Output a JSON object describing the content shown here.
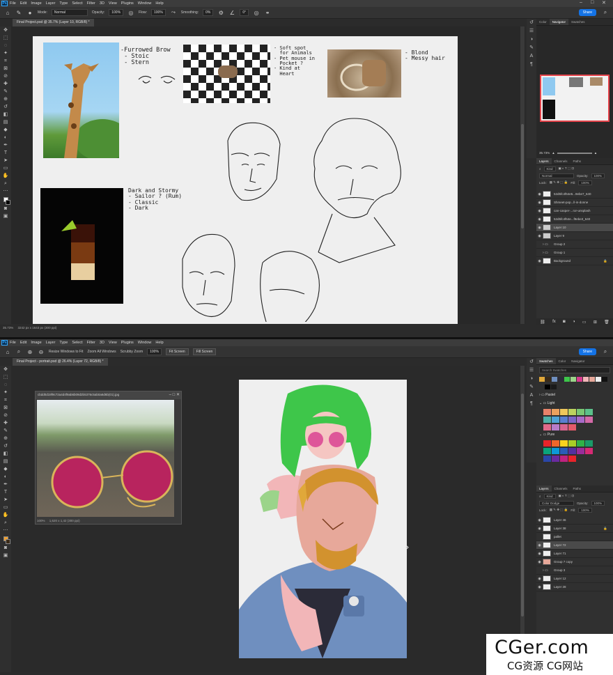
{
  "top": {
    "menu": [
      "File",
      "Edit",
      "Image",
      "Layer",
      "Type",
      "Select",
      "Filter",
      "3D",
      "View",
      "Plugins",
      "Window",
      "Help"
    ],
    "options": {
      "mode_label": "Mode:",
      "mode": "Normal",
      "opacity_label": "Opacity:",
      "opacity": "100%",
      "flow_label": "Flow:",
      "flow": "100%",
      "smoothing_label": "Smoothing:",
      "smoothing": "0%",
      "angle": "0°"
    },
    "share": "Share",
    "doc_tab": "Final Project.psd @ 35.7% (Layer 10, RGB/8) *",
    "status": "35.73%",
    "status_dims": "3242 px x 1643 px (300 ppi)",
    "notes": {
      "giraffe": "-Furrowed Brow\n - Stoic\n - Stern",
      "shirt": "- Soft spot\n  for Animals\n- Pet mouse in\n  Pocket ?\n- Kind at\n  Heart",
      "rope": "- Blond\n- Messy hair",
      "drink": "Dark and Stormy\n- Sailor ? (Rum)\n- Classic\n- Dark"
    },
    "panel_tabs": [
      "Color",
      "Navigator",
      "Swatches"
    ],
    "nav_zoom": "35.73%",
    "layers_tabs": [
      "Layers",
      "Channels",
      "Paths"
    ],
    "kind": "Kind",
    "blend": "Normal",
    "opacity_label": "Opacity:",
    "opacity": "100%",
    "lock_label": "Lock:",
    "fill_label": "Fill:",
    "fill": "100%",
    "layers": [
      "52d5fc4f64e5...9ebe7_640",
      "Shmeet-pop...ll-in-donne",
      "can-casper-...ror-unsplash",
      "52d5fc4f64e...f9ebe3_640",
      "Layer 10",
      "Layer 9",
      "Group 2",
      "Group 1",
      "Background"
    ]
  },
  "bottom": {
    "menu": [
      "File",
      "Edit",
      "Image",
      "Layer",
      "Type",
      "Select",
      "Filter",
      "3D",
      "View",
      "Plugins",
      "Window",
      "Help"
    ],
    "options": {
      "resize": "Resize Windows to Fit",
      "zoom_all": "Zoom All Windows",
      "scrubby": "Scrubby Zoom",
      "zoom": "100%",
      "fit": "Fit Screen",
      "fill": "Fill Screen"
    },
    "share": "Share",
    "doc_tab": "Final Project - portrait.psd @ 26.4% (Layer 72, RGB/8) *",
    "float_title": "cbdd0d19f9c72a4d4f9ab6b09d2b5376c5ab0a6d6b(01).jpg",
    "float_status": "100%",
    "float_dims": "1,620 x 1,42 (300 ppi)",
    "panel_tabs": [
      "Swatches",
      "Color",
      "Navigator"
    ],
    "search": "Search Swatches",
    "groups": [
      "Pastel",
      "Light",
      "Pure"
    ],
    "layers_tabs": [
      "Layers",
      "Channels",
      "Paths"
    ],
    "kind": "Kind",
    "blend": "Color Dodge",
    "opacity_label": "Opacity:",
    "opacity": "100%",
    "lock_label": "Lock:",
    "fill_label": "Fill:",
    "fill": "100%",
    "layers": [
      "Layer 46",
      "Layer 38",
      "pallet",
      "Layer 72",
      "Layer 71",
      "Group 7 copy",
      "Group 3",
      "Layer 12",
      "Layer 28"
    ]
  },
  "watermark": {
    "title": "CGer.com",
    "subtitle": "CG资源 CG网站"
  },
  "colors": {
    "accent": "#1473e6",
    "hair": "#3ec64a",
    "lenses": "#d83a8e",
    "shirt": "#6f8fbf",
    "beard": "#e0a83a"
  }
}
